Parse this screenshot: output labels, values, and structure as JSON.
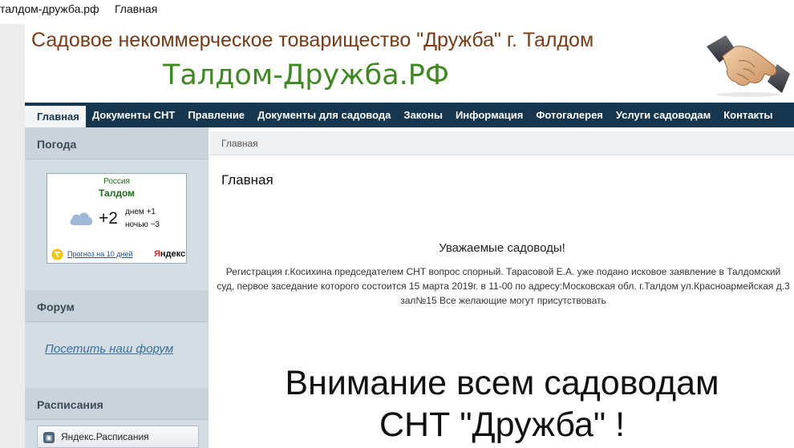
{
  "topbar": {
    "domain": "талдом-дружба.рф",
    "page": "Главная"
  },
  "header": {
    "title": "Садовое некоммерческое товарищество \"Дружба\" г. Талдом",
    "domain": "Талдом-Дружба.РФ",
    "logo_icon": "handshake-icon"
  },
  "nav": {
    "items": [
      "Главная",
      "Документы СНТ",
      "Правление",
      "Документы для садовода",
      "Законы",
      "Информация",
      "Фотогалерея",
      "Услуги садоводам",
      "Контакты"
    ],
    "active": "Главная"
  },
  "sidebar": {
    "weather_heading": "Погода",
    "weather": {
      "country": "Россия",
      "city": "Талдом",
      "temp": "+2",
      "day": "днем +1",
      "night": "ночью −3",
      "forecast_link": "Прогноз на 10 дней",
      "provider": "Яндекс",
      "provider_first": "Я",
      "provider_rest": "ндекс",
      "icon": "cloud-icon"
    },
    "forum_heading": "Форум",
    "forum_link": "Посетить наш форум",
    "schedule_heading": "Расписания",
    "schedule_button": "Яндекс.Расписания"
  },
  "main": {
    "breadcrumb": "Главная",
    "title": "Главная",
    "greeting": "Уважаемые садоводы!",
    "announcement": "Регистрация г.Косихина  председателем СНТ вопрос спорный. Тарасовой Е.А. уже подано исковое заявление в Талдомский суд, первое заседание которого состоится 15 марта 2019г. в 11-00 по адресу:Московская обл. г.Талдом ул.Красноармейская д.3 зал№15 Все желающие могут присутствовать",
    "attention_line1": "Внимание всем садоводам",
    "attention_line2": "СНТ \"Дружба\" !"
  },
  "colors": {
    "nav_bg": "#16364f",
    "title_brown": "#7a3a14",
    "domain_green": "#3d8a1f",
    "sidebar_bg": "#d4dde3"
  }
}
